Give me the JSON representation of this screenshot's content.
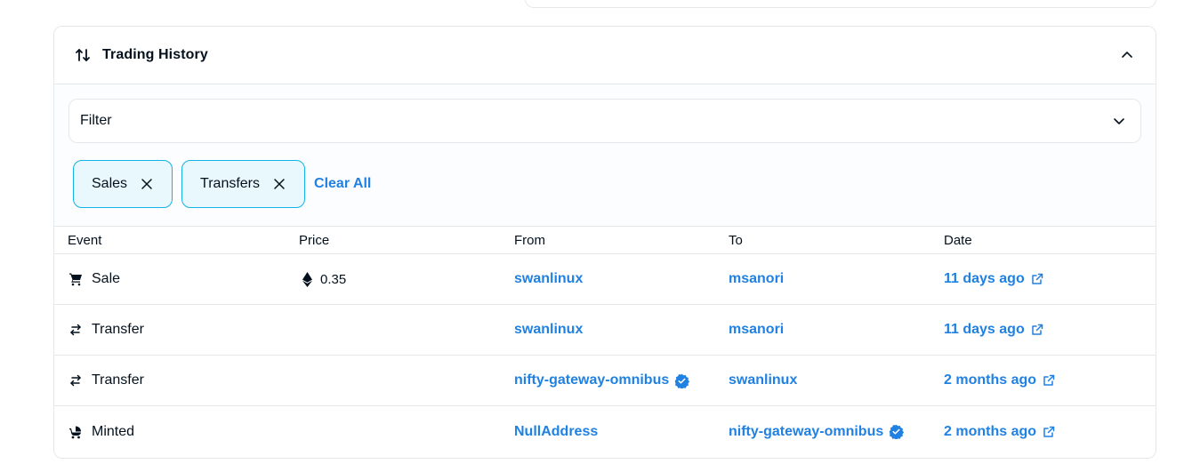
{
  "panel": {
    "title": "Trading History"
  },
  "filter": {
    "label": "Filter"
  },
  "chips": [
    {
      "label": "Sales"
    },
    {
      "label": "Transfers"
    }
  ],
  "clear_all": "Clear All",
  "table": {
    "headers": {
      "event": "Event",
      "price": "Price",
      "from": "From",
      "to": "To",
      "date": "Date"
    },
    "rows": [
      {
        "event": "Sale",
        "event_icon": "cart-icon",
        "price": "0.35",
        "from": "swanlinux",
        "from_verified": false,
        "to": "msanori",
        "to_verified": false,
        "date": "11 days ago"
      },
      {
        "event": "Transfer",
        "event_icon": "transfer-icon",
        "price": "",
        "from": "swanlinux",
        "from_verified": false,
        "to": "msanori",
        "to_verified": false,
        "date": "11 days ago"
      },
      {
        "event": "Transfer",
        "event_icon": "transfer-icon",
        "price": "",
        "from": "nifty-gateway-omnibus",
        "from_verified": true,
        "to": "swanlinux",
        "to_verified": false,
        "date": "2 months ago"
      },
      {
        "event": "Minted",
        "event_icon": "stroller-icon",
        "price": "",
        "from": "NullAddress",
        "from_verified": false,
        "to": "nifty-gateway-omnibus",
        "to_verified": true,
        "date": "2 months ago"
      }
    ]
  },
  "colors": {
    "link": "#2081e2",
    "chip_border": "#15b2e5",
    "chip_bg": "#e9f8fc",
    "verified": "#2081e2",
    "text": "#04111d",
    "border": "#e5e8eb"
  }
}
